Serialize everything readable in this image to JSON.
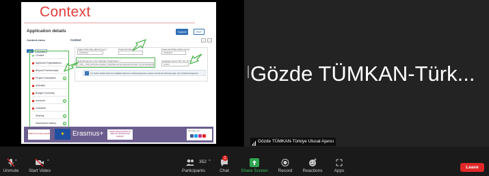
{
  "slide": {
    "title": "Context",
    "app_details_title": "Application details",
    "btn_submit": "Submit",
    "btn_pdf": "PDF",
    "content_menu_title": "Content menu",
    "cm_btn_1": "On",
    "cm_btn_2": "Off/Open",
    "context_heading": "Context",
    "menu_items": [
      {
        "label": "Context",
        "mark": "ok"
      },
      {
        "label": "Applicant Organisations",
        "mark": "x"
      },
      {
        "label": "Beyond Partnerships",
        "mark": "x"
      },
      {
        "label": "Project Description",
        "mark": "x",
        "count": "1"
      },
      {
        "label": "Activities",
        "mark": "x"
      },
      {
        "label": "Budget Summary",
        "mark": "x"
      },
      {
        "label": "Annexes",
        "mark": "x",
        "count": "1"
      },
      {
        "label": "Checklist",
        "mark": "x"
      },
      {
        "label": "Sharing",
        "count": "1"
      },
      {
        "label": "Submission history",
        "count": "1"
      }
    ],
    "fields": {
      "title_label": "Project Start date (dd/mm/yyyy) *",
      "title_value": "01/09/2022",
      "duration_label": "Project Duration *",
      "duration_value": "",
      "end_label": "Project End Date (dd/mm/yyyy)",
      "end_value": "31/08/2023",
      "agency_label": "National Agency of the Applicant Organisation *",
      "agency_value": "TR01 - TURK NATIONAL AGENCY (CENTRE FOR EU EDUCATION AND YOUTH PROGRAMMES) (TURKEY)",
      "language_label": "Language used to fill in the form *",
      "language_value": "Turkish"
    },
    "info_text": "For further details about the available Erasmus+ National Agencies, please consult the following page: List of National Agencies",
    "footer": {
      "logo_left": "TÜRKİYE ULUSAL AJANSI",
      "erasmus": "Erasmus+",
      "logo_ua": "AVRUPA BİRLİĞİ EĞİTİM VE GENÇLİK PROGRAMLARI MERKEZİ",
      "social_text": "Bizi takip edin"
    }
  },
  "speaker": {
    "display_name": "Gözde TÜMKAN-Türk...",
    "tag_name": "Gözde TÜMKAN-Türkiye Ulusal Ajansı"
  },
  "toolbar": {
    "unmute": "Unmute",
    "start_video": "Start Video",
    "participants": "Participants",
    "participant_count": "352",
    "chat": "Chat",
    "chat_badge": "1",
    "share_screen": "Share Screen",
    "record": "Record",
    "reactions": "Reactions",
    "apps": "Apps",
    "leave": "Leave"
  },
  "colors": {
    "accent_red": "#e02828",
    "share_green": "#2ea44f",
    "annotation_green": "#4bb34b",
    "slide_title_red": "#e03b3b"
  }
}
